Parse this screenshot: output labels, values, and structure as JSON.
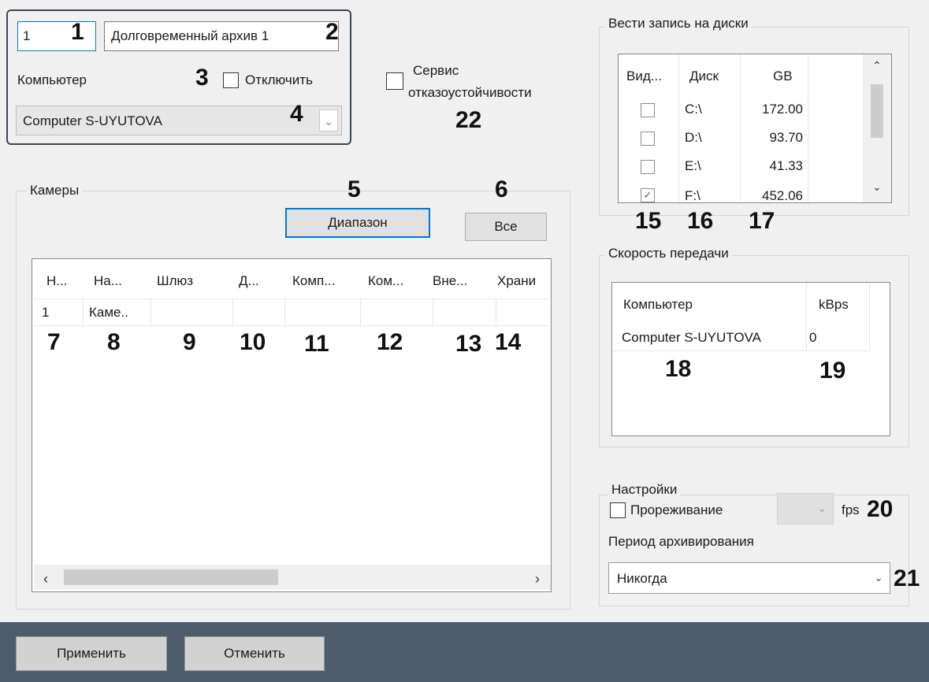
{
  "archive": {
    "id": "1",
    "name": "Долговременный архив 1"
  },
  "computer": {
    "label": "Компьютер",
    "disable_label": "Отключить",
    "selected": "Computer S-UYUTOVA"
  },
  "service": {
    "label_line1": "Сервис",
    "label_line2": "отказоустойчивости"
  },
  "cameras": {
    "group_title": "Камеры",
    "range_button": "Диапазон",
    "all_button": "Все",
    "columns": [
      "Н...",
      "На...",
      "Шлюз",
      "Д...",
      "Комп...",
      "Ком...",
      "Вне...",
      "Храни"
    ],
    "rows": [
      [
        "1",
        "Каме.."
      ]
    ]
  },
  "disks": {
    "group_title": "Вести запись на диски",
    "columns": [
      "Вид...",
      "Диск",
      "GB"
    ],
    "rows": [
      {
        "disk": "C:\\",
        "gb": "172.00",
        "checked": false
      },
      {
        "disk": "D:\\",
        "gb": "93.70",
        "checked": false
      },
      {
        "disk": "E:\\",
        "gb": "41.33",
        "checked": false
      },
      {
        "disk": "F:\\",
        "gb": "452.06",
        "checked": true
      }
    ]
  },
  "speed": {
    "group_title": "Скорость передачи",
    "columns": [
      "Компьютер",
      "kBps"
    ],
    "rows": [
      [
        "Computer S-UYUTOVA",
        "0"
      ]
    ]
  },
  "settings": {
    "group_title": "Настройки",
    "thinning_label": "Прореживание",
    "fps_label": "fps",
    "period_label": "Период архивирования",
    "period_value": "Никогда"
  },
  "actions": {
    "apply": "Применить",
    "cancel": "Отменить"
  },
  "callouts": [
    "1",
    "2",
    "3",
    "4",
    "5",
    "6",
    "7",
    "8",
    "9",
    "10",
    "11",
    "12",
    "13",
    "14",
    "15",
    "16",
    "17",
    "18",
    "19",
    "20",
    "21",
    "22"
  ],
  "colors": {
    "accent": "#0078d7",
    "bottom_bar": "#4e5b6b"
  }
}
